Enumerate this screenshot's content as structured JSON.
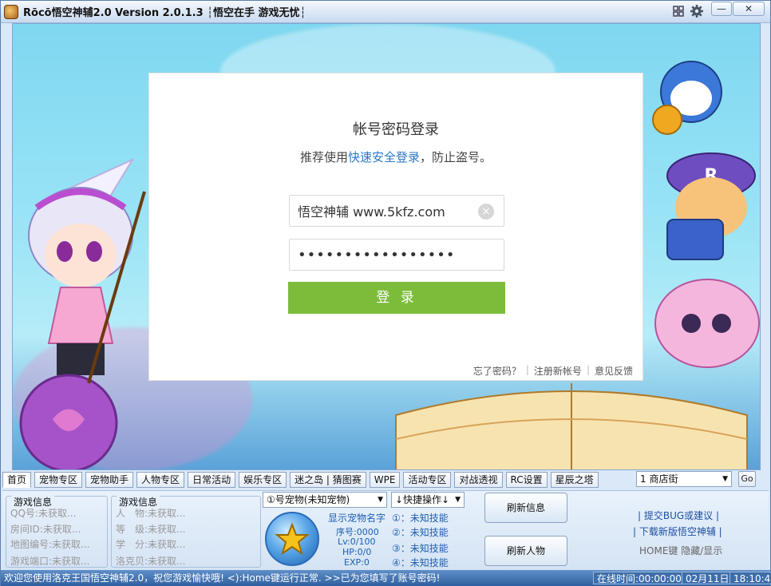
{
  "window": {
    "title": "Rōcō悟空神辅2.0 Version 2.0.1.3 ┆悟空在手 游戏无忧┆",
    "minimize": "—",
    "close": "✕"
  },
  "login": {
    "title": "帐号密码登录",
    "subtitle_prefix": "推荐使用",
    "subtitle_link": "快速安全登录",
    "subtitle_suffix": "，防止盗号。",
    "account_value": "悟空神辅  www.5kfz.com",
    "password_value": "•••••••••••••••••",
    "login_button": "登 录",
    "forgot": "忘了密码？",
    "register": "注册新帐号",
    "feedback": "意见反馈",
    "sep": "|"
  },
  "tabs": [
    "首页",
    "宠物专区",
    "宠物助手",
    "人物专区",
    "日常活动",
    "娱乐专区",
    "迷之岛 | 猜图赛",
    "WPE",
    "活动专区",
    "对战透视",
    "RC设置",
    "星辰之塔"
  ],
  "scene_select": {
    "value": "1 商店街",
    "arrow": "▼"
  },
  "go_button": "Go",
  "game_info": {
    "title": "游戏信息",
    "qq_label": "QQ号:",
    "qq_value": "未获取...",
    "room_label": "房间ID:",
    "room_value": "未获取...",
    "map_label": "地图编号:",
    "map_value": "未获取...",
    "port_label": "游戏端口:",
    "port_value": "未获取..."
  },
  "char_info": {
    "title": "游戏信息",
    "char_label": "人　物:",
    "char_value": "未获取...",
    "level_label": "等　级:",
    "level_value": "未获取...",
    "study_label": "学　分:",
    "study_value": "未获取...",
    "beans_label": "洛克贝:",
    "beans_value": "未获取..."
  },
  "pet": {
    "select_value": "①号宠物(未知宠物)",
    "quick_ops": "↓快捷操作↓",
    "name_label": "显示宠物名字",
    "serial": "序号:0000",
    "lv": "Lv:0/100",
    "hp": "HP:0/0",
    "exp": "EXP:0",
    "skills": [
      "①：未知技能",
      "②：未知技能",
      "③：未知技能",
      "④：未知技能"
    ]
  },
  "buttons": {
    "refresh_info": "刷新信息",
    "refresh_char": "刷新人物"
  },
  "links": {
    "bug": "| 提交BUG或建议 |",
    "download": "| 下载新版悟空神辅 |",
    "home_hint": "HOME键 隐藏/显示"
  },
  "status": {
    "message": "欢迎您使用洛克王国悟空神辅2.0，祝您游戏愉快哦!  <):Home键运行正常.  >>已为您填写了账号密码!",
    "online": "在线时间:00:00:00",
    "date": "02月11日",
    "time": "18:10:49"
  },
  "colors": {
    "login_button": "#7cbc3a",
    "link": "#2a78c5",
    "statusbar": "#2f5f9f"
  }
}
